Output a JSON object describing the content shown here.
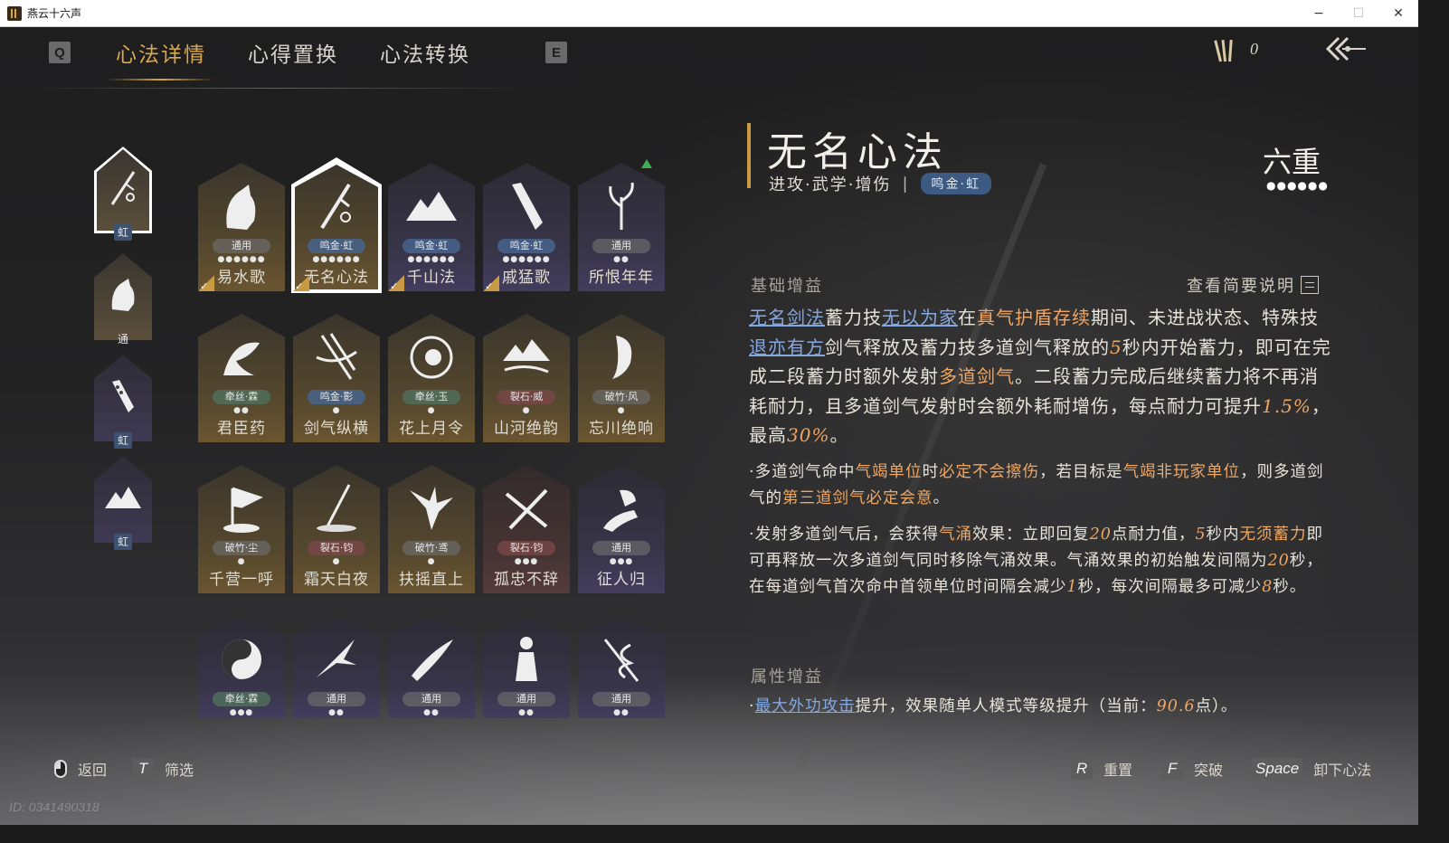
{
  "window": {
    "title": "燕云十六声",
    "min": "−",
    "max": "☐",
    "close": "✕"
  },
  "nav": {
    "key_prev": "Q",
    "key_next": "E",
    "tabs": [
      {
        "label": "心法详情",
        "active": true
      },
      {
        "label": "心得置换",
        "active": false
      },
      {
        "label": "心法转换",
        "active": false
      }
    ]
  },
  "currency": {
    "count": "0"
  },
  "equipped": [
    {
      "name": "sword-icon",
      "rank": "虹",
      "selected": true
    },
    {
      "name": "horse-icon",
      "rank": "通",
      "selected": false
    },
    {
      "name": "arm-icon",
      "rank": "虹",
      "selected": false
    },
    {
      "name": "mountain-icon",
      "rank": "虹",
      "selected": false
    }
  ],
  "cards": [
    {
      "name": "易水歌",
      "tag": "通用",
      "dots": "●●●●●●",
      "icon": "horse-icon",
      "style": "gold",
      "check": true
    },
    {
      "name": "无名心法",
      "tag": "鸣金·虹",
      "dots": "●●●●●●",
      "icon": "sword-icon",
      "style": "gold",
      "check": true,
      "selected": true
    },
    {
      "name": "千山法",
      "tag": "鸣金·虹",
      "dots": "●●●●●●",
      "icon": "mountain-icon",
      "style": "purple",
      "check": true
    },
    {
      "name": "戚猛歌",
      "tag": "鸣金·虹",
      "dots": "●●●●●●",
      "icon": "arm-icon",
      "style": "purple",
      "check": true
    },
    {
      "name": "所恨年年",
      "tag": "通用",
      "dots": "●●",
      "icon": "plant-icon",
      "style": "purple",
      "up": true
    },
    {
      "name": "君臣药",
      "tag": "牵丝·霖",
      "dots": "●●",
      "icon": "herb-icon",
      "style": "gold"
    },
    {
      "name": "剑气纵横",
      "tag": "鸣金·影",
      "dots": "●",
      "icon": "blades-icon",
      "style": "gold"
    },
    {
      "name": "花上月令",
      "tag": "牵丝·玉",
      "dots": "●",
      "icon": "flower-icon",
      "style": "gold"
    },
    {
      "name": "山河绝韵",
      "tag": "裂石·威",
      "dots": "●",
      "icon": "river-icon",
      "style": "gold"
    },
    {
      "name": "忘川绝响",
      "tag": "破竹·风",
      "dots": "●",
      "icon": "face-icon",
      "style": "gold"
    },
    {
      "name": "千营一呼",
      "tag": "破竹·尘",
      "dots": "●",
      "icon": "flag-icon",
      "style": "gold"
    },
    {
      "name": "霜天白夜",
      "tag": "裂石·钧",
      "dots": "●",
      "icon": "spear-icon",
      "style": "gold"
    },
    {
      "name": "扶摇直上",
      "tag": "破竹·鸢",
      "dots": "●",
      "icon": "eagle-icon",
      "style": "gold"
    },
    {
      "name": "孤忠不辞",
      "tag": "裂石·钧",
      "dots": "●●●",
      "icon": "crossblades-icon",
      "style": "red"
    },
    {
      "name": "征人归",
      "tag": "通用",
      "dots": "●●●",
      "icon": "bird-hand-icon",
      "style": "purple"
    },
    {
      "name": "",
      "tag": "牵丝·霖",
      "dots": "●●●",
      "icon": "yinyang-icon",
      "style": "purple"
    },
    {
      "name": "",
      "tag": "通用",
      "dots": "●●",
      "icon": "swallow-icon",
      "style": "purple"
    },
    {
      "name": "",
      "tag": "通用",
      "dots": "●●",
      "icon": "feather-blade-icon",
      "style": "purple"
    },
    {
      "name": "",
      "tag": "通用",
      "dots": "●●",
      "icon": "figure-icon",
      "style": "purple"
    },
    {
      "name": "",
      "tag": "通用",
      "dots": "●●",
      "icon": "snake-sword-icon",
      "style": "purple"
    }
  ],
  "detail": {
    "name": "无名心法",
    "subtitle": "进攻·武学·增伤",
    "sep": "|",
    "pill": "鸣金·虹",
    "level": "六重",
    "level_dots": "●●●●●●",
    "section_base": "基础增益",
    "view_desc": "查看简要说明",
    "main_text": {
      "s1": "无名剑法",
      "s2": "蓄力技",
      "s3": "无以为家",
      "s4": "在",
      "s5": "真气护盾存续",
      "s6": "期间、未进战状态、特殊技",
      "s7": "退亦有方",
      "s8": "剑气释放及蓄力技多道剑气释放的",
      "s9": "5",
      "s10": "秒内开始蓄力，即可在完成二段蓄力时额外发射",
      "s11": "多道剑气",
      "s12": "。二段蓄力完成后继续蓄力将不再消耗耐力，且多道剑气发射时会额外耗耐增伤，每点耐力可提升",
      "s13": "1.5%",
      "s14": "，最高",
      "s15": "30%",
      "s16": "。"
    },
    "bullet1": {
      "a": "·多道剑气命中",
      "b": "气竭单位",
      "c": "时",
      "d": "必定不会擦伤",
      "e": "，若目标是",
      "f": "气竭非玩家单位",
      "g": "，则多道剑气的",
      "h": "第三道剑气必定会意",
      "i": "。"
    },
    "bullet2": {
      "a": "·发射多道剑气后，会获得",
      "b": "气涌",
      "c": "效果：立即回复",
      "d": "20",
      "e": "点耐力值，",
      "f": "5",
      "g": "秒内",
      "h": "无须蓄力",
      "i": "即可再释放一次多道剑气同时移除气涌效果。气涌效果的初始触发间隔为",
      "j": "20",
      "k": "秒，在每道剑气首次命中首领单位时间隔会减少",
      "l": "1",
      "m": "秒，每次间隔最多可减少",
      "n": "8",
      "o": "秒。"
    },
    "section_attr": "属性增益",
    "attr": {
      "a": "·",
      "b": "最大外功攻击",
      "c": "提升，效果随单人模式等级提升（当前：",
      "d": "90.6",
      "e": "点）。"
    }
  },
  "bottom": {
    "back": "返回",
    "filter_key": "T",
    "filter": "筛选",
    "reset_key": "R",
    "reset": "重置",
    "break_key": "F",
    "break": "突破",
    "unload_key": "Space",
    "unload": "卸下心法"
  },
  "uid": "ID: 0341490318",
  "colors": {
    "gold": "#d9a84a",
    "orange": "#f0a763",
    "blue_link": "#86a8e0",
    "pill_blue": "#3c5a82"
  }
}
